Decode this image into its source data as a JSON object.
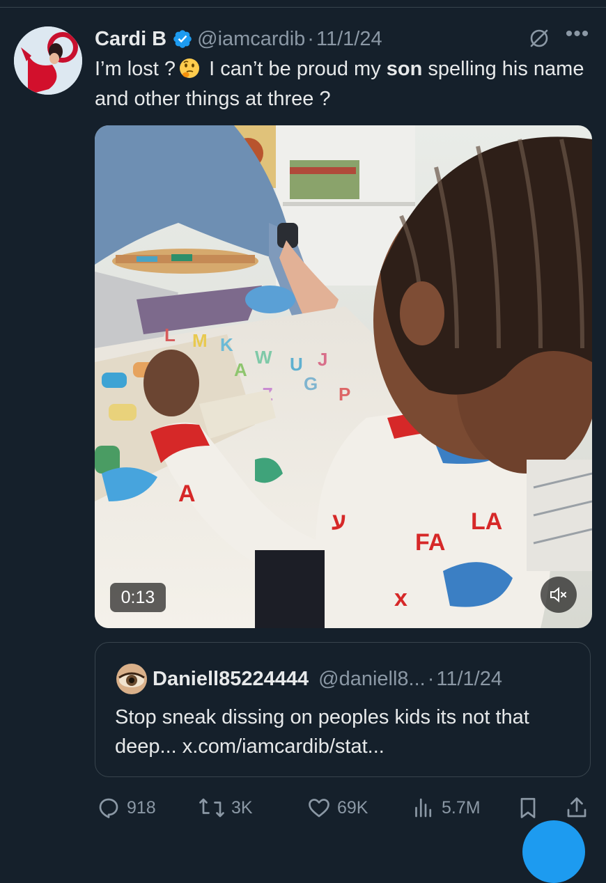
{
  "tweet": {
    "display_name": "Cardi B",
    "handle": "@iamcardib",
    "separator": "·",
    "date": "11/1/24",
    "text_before": "I’m lost ?",
    "text_mid": " I can’t be proud my ",
    "text_bold": "son",
    "text_after": " spelling his name and other things at three ?",
    "icons": {
      "verified": "verified-badge-icon",
      "grok": "grok-icon",
      "more": "more-icon",
      "emoji": "thinking-face-emoji"
    }
  },
  "video": {
    "timestamp": "0:13",
    "mute_icon": "volume-muted-icon"
  },
  "quote": {
    "display_name": "Daniell85224444",
    "handle": "@daniell8...",
    "separator": "·",
    "date": "11/1/24",
    "text": "Stop sneak dissing on peoples kids its not that deep... x.com/iamcardib/stat..."
  },
  "actions": {
    "replies": "918",
    "reposts": "3K",
    "likes": "69K",
    "views": "5.7M"
  },
  "colors": {
    "background": "#15202b",
    "border": "#38444d",
    "text_primary": "#e7e9ea",
    "text_secondary": "#8b98a5",
    "accent": "#1d9bf0"
  }
}
